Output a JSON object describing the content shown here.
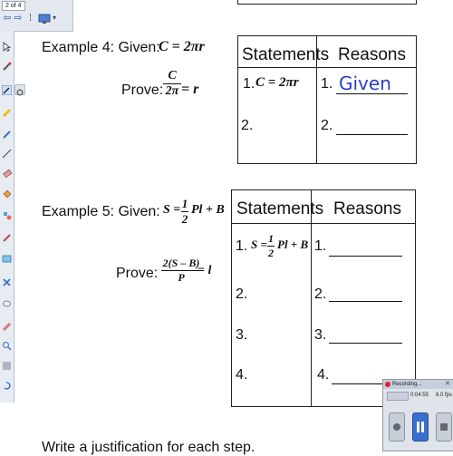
{
  "topbar": {
    "page_indicator": "2 of 4",
    "prev_glyph": "⇦",
    "next_glyph": "⇨",
    "menu_glyph": "⁞",
    "dropdown_glyph": "▾"
  },
  "left_toolbar": {
    "tools": [
      "select-arrow-icon",
      "hand-pointer-icon",
      "magic-wand-icon",
      "pen-icon",
      "highlighter-icon",
      "eraser-icon",
      "line-icon",
      "shape-icon",
      "text-icon",
      "fill-icon",
      "table-icon",
      "capture-icon",
      "delete-icon",
      "undo-icon",
      "lasso-icon",
      "magnifier-icon",
      "screen-shade-icon",
      "redo-icon",
      "page-icon"
    ]
  },
  "example4": {
    "label": "Example 4:  Given:",
    "given": "C = 2πr",
    "prove_label": "Prove:",
    "prove_num": "C",
    "prove_den": "2π",
    "prove_rhs": "= r",
    "table": {
      "col1": "Statements",
      "col2": "Reasons",
      "rows": [
        {
          "num": "1.",
          "statement": "C = 2πr",
          "rnum": "1.",
          "reason": "Given"
        },
        {
          "num": "2.",
          "statement": "",
          "rnum": "2.",
          "reason": ""
        }
      ]
    }
  },
  "example5": {
    "label": "Example 5:  Given:",
    "given_lhs": "S =",
    "given_num": "1",
    "given_den": "2",
    "given_rhs": "Pl + B",
    "prove_label": "Prove:",
    "prove_num": "2(S – B)",
    "prove_den": "P",
    "prove_rhs": "= l",
    "table": {
      "col1": "Statements",
      "col2": "Reasons",
      "rows": [
        {
          "num": "1.",
          "statement_lhs": "S =",
          "statement_num": "1",
          "statement_den": "2",
          "statement_rhs": "Pl + B",
          "rnum": "1."
        },
        {
          "num": "2.",
          "rnum": "2."
        },
        {
          "num": "3.",
          "rnum": "3."
        },
        {
          "num": "4.",
          "rnum": "4."
        }
      ]
    }
  },
  "footer_instruction": "Write a justification for each step.",
  "recorder": {
    "title": "Recording...",
    "time": "0:04:55",
    "fps": "8.0 fps",
    "close_glyph": "✕"
  },
  "colors": {
    "handwriting": "#2a3fc4",
    "toolbar_bg": "#e7ebf2"
  }
}
